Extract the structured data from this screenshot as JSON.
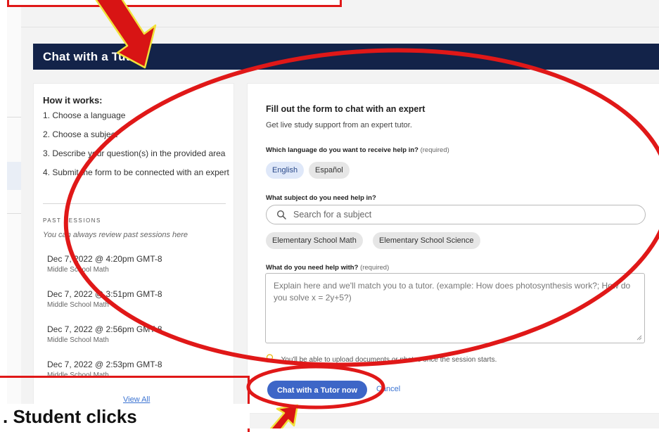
{
  "header": {
    "title": "Chat with a Tutor"
  },
  "how_it_works": {
    "title": "How it works:",
    "steps": [
      "1. Choose a language",
      "2. Choose a subject",
      "3. Describe your question(s) in the provided area",
      "4. Submit the form to be connected with an expert"
    ]
  },
  "past_sessions": {
    "label": "PAST SESSIONS",
    "description": "You can always review past sessions here",
    "items": [
      {
        "date": "Dec 7, 2022 @ 4:20pm GMT-8",
        "subject": "Middle School Math"
      },
      {
        "date": "Dec 7, 2022 @ 3:51pm GMT-8",
        "subject": "Middle School Math"
      },
      {
        "date": "Dec 7, 2022 @ 2:56pm GMT-8",
        "subject": "Middle School Math"
      },
      {
        "date": "Dec 7, 2022 @ 2:53pm GMT-8",
        "subject": "Middle School Math"
      }
    ],
    "view_all": "View All"
  },
  "form": {
    "title": "Fill out the form to chat with an expert",
    "subtitle": "Get live study support from an expert tutor.",
    "language_question": "Which language do you want to receive help in?",
    "required_tag": "(required)",
    "languages": [
      {
        "label": "English",
        "selected": true
      },
      {
        "label": "Español",
        "selected": false
      }
    ],
    "subject_question": "What subject do you need help in?",
    "search_placeholder": "Search for a subject",
    "subject_suggestions": [
      "Elementary School Math",
      "Elementary School Science"
    ],
    "help_question": "What do you need help with?",
    "help_placeholder": "Explain here and we'll match you to a tutor. (example: How does photosynthesis work?; How do you solve x = 2y+5?)",
    "upload_note": "You'll be able to upload documents or photos once the session starts.",
    "submit_label": "Chat with a Tutor now",
    "cancel_label": "Cancel"
  },
  "annotation": {
    "caption": "Student clicks",
    "color": "#e01818",
    "arrow_color": "#e01818",
    "arrow_outline": "#f5e63a"
  },
  "colors": {
    "header_bg": "#132349",
    "primary_button": "#3d66c7",
    "link": "#3b73d2",
    "selected_chip": "#dfe8f9"
  }
}
